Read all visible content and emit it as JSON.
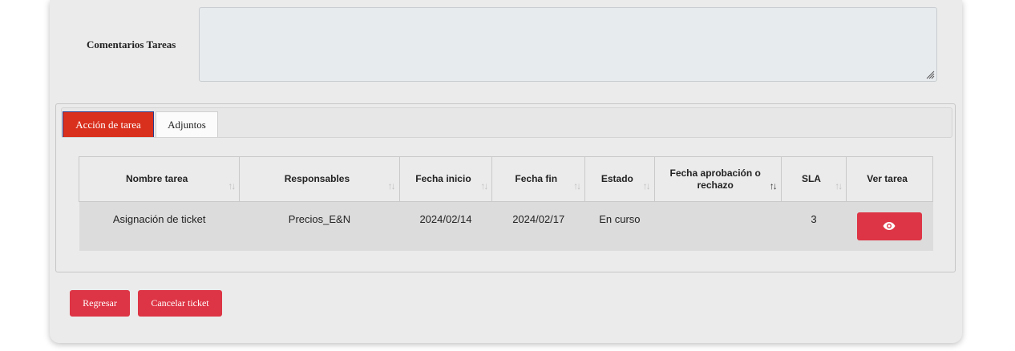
{
  "form": {
    "comments_label": "Comentarios Tareas",
    "comments_value": ""
  },
  "tabs": [
    {
      "label": "Acción de tarea",
      "active": true
    },
    {
      "label": "Adjuntos",
      "active": false
    }
  ],
  "table": {
    "headers": [
      "Nombre tarea",
      "Responsables",
      "Fecha inicio",
      "Fecha fin",
      "Estado",
      "Fecha aprobación o rechazo",
      "SLA",
      "Ver tarea"
    ],
    "rows": [
      {
        "nombre": "Asignación de ticket",
        "responsables": "Precios_E&N",
        "fecha_inicio": "2024/02/14",
        "fecha_fin": "2024/02/17",
        "estado": "En curso",
        "fecha_aprobacion": "",
        "sla": "3",
        "ver_icon": "eye-icon"
      }
    ]
  },
  "actions": {
    "back_label": "Regresar",
    "cancel_label": "Cancelar ticket"
  },
  "colors": {
    "accent": "#dd3545",
    "active_tab": "#d9301d"
  }
}
